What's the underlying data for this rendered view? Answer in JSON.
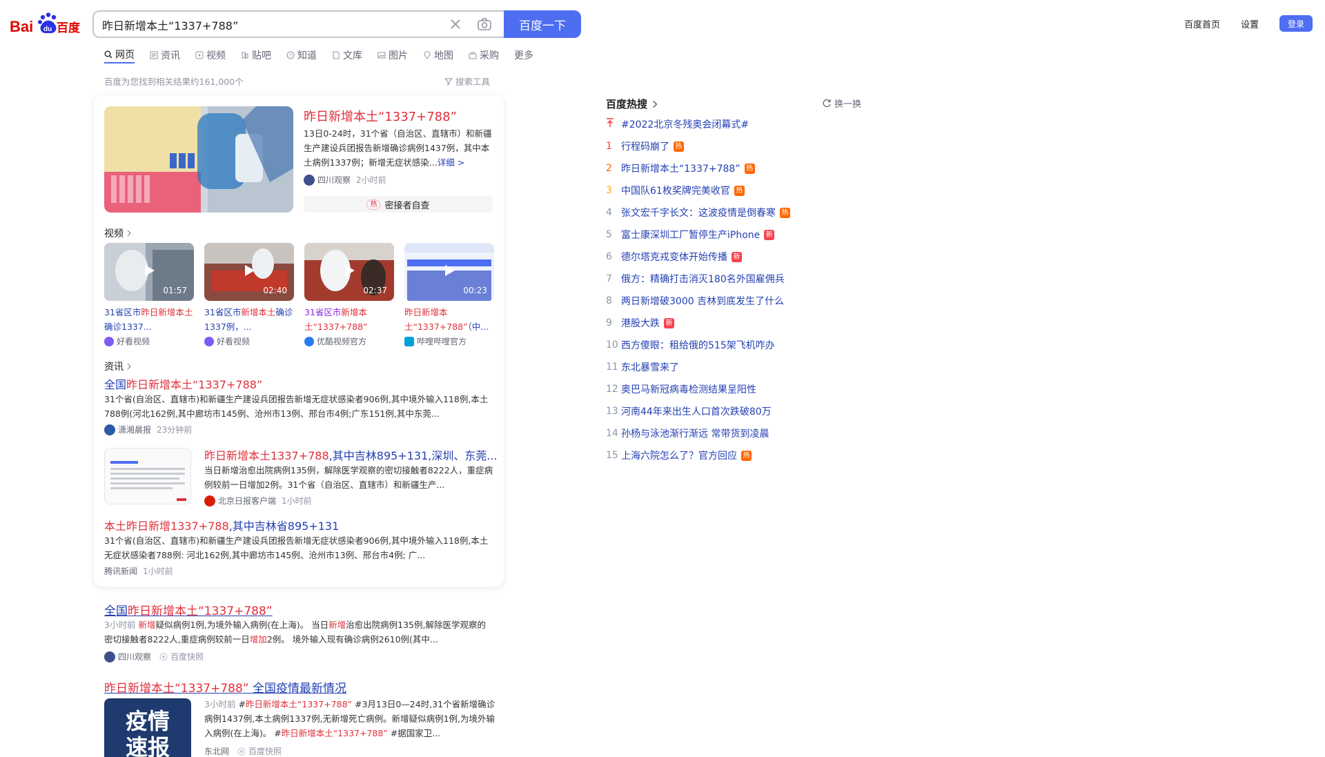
{
  "logo": {
    "text_left": "Bai",
    "text_right": "百度"
  },
  "search": {
    "query": "昨日新增本土“1337+788”",
    "button_label": "百度一下"
  },
  "top_links": {
    "home": "百度首页",
    "settings": "设置",
    "login": "登录"
  },
  "tabs": [
    {
      "label": "网页",
      "icon": "search-icon",
      "active": true
    },
    {
      "label": "资讯",
      "icon": "news-icon"
    },
    {
      "label": "视频",
      "icon": "video-icon"
    },
    {
      "label": "贴吧",
      "icon": "tieba-icon"
    },
    {
      "label": "知道",
      "icon": "question-icon"
    },
    {
      "label": "文库",
      "icon": "doc-icon"
    },
    {
      "label": "图片",
      "icon": "image-icon"
    },
    {
      "label": "地图",
      "icon": "map-icon"
    },
    {
      "label": "采购",
      "icon": "shop-icon"
    },
    {
      "label": "更多"
    }
  ],
  "result_count": "百度为您找到相关结果约161,000个",
  "search_tools": "搜索工具",
  "top_result": {
    "title": "昨日新增本土“1337+788”",
    "abstract": "13日0-24时，31个省（自治区、直辖市）和新疆生产建设兵团报告新增确诊病例1437例，其中本土病例1337例；新增无症状感染...",
    "more": "详细 >",
    "source": "四川观察",
    "time": "2小时前",
    "hot_pill": "热",
    "hot_text": "密接者自查"
  },
  "video_section": {
    "label": "视频",
    "items": [
      {
        "duration": "01:57",
        "title_plain": "31省区市",
        "title_em": "昨日新增本土",
        "title_rest": "确诊1337...",
        "source": "好看视频",
        "src_color": "#7b5cf5"
      },
      {
        "duration": "02:40",
        "title_plain": "31省区市",
        "title_em": "新增本土",
        "title_rest": "确诊1337例，...",
        "source": "好看视频",
        "src_color": "#7b5cf5"
      },
      {
        "duration": "02:37",
        "title_plain": "31省区市",
        "title_em": "新增本土“1337+788”",
        "title_rest": "",
        "source": "优酷视频官方",
        "src_color": "#2a7cf5"
      },
      {
        "duration": "00:23",
        "title_plain": "",
        "title_em": "昨日新增本土“1337+788”",
        "title_rest": "（中...",
        "source": "哔哩哔哩官方",
        "src_color": "#00a1d6"
      }
    ]
  },
  "news_section": {
    "label": "资讯",
    "items": [
      {
        "title_plain": "全国",
        "title_em": "昨日新增本土“1337+788”",
        "title_rest": "",
        "abstract": "31个省(自治区、直辖市)和新疆生产建设兵团报告新增无症状感染者906例,其中境外输入118例,本土788例(河北162例,其中廊坊市145例、沧州市13例、邢台市4例;广东151例,其中东莞...",
        "source": "潇湘晨报",
        "time": "23分钟前"
      },
      {
        "title_plain": "",
        "title_em": "昨日新增本土1337+788",
        "title_rest": ",其中吉林895+131,深圳、东莞...",
        "abstract": "当日新增治愈出院病例135例，解除医学观察的密切接触者8222人，重症病例较前一日增加2例。31个省（自治区、直辖市）和新疆生产...",
        "source": "北京日报客户端",
        "time": "1小时前"
      },
      {
        "title_plain": "本土",
        "title_em": "昨日新增1337+788",
        "title_rest": ",其中吉林省895+131",
        "abstract": "31个省(自治区、直辖市)和新疆生产建设兵团报告新增无症状感染者906例,其中境外输入118例,本土无症状感染者788例: 河北162例,其中廊坊市145例、沧州市13例、邢台市4例; 广...",
        "source": "腾讯新闻",
        "time": "1小时前"
      }
    ]
  },
  "results": [
    {
      "title_plain": "全国",
      "title_em": "昨日新增本土“1337+788”",
      "title_rest": "",
      "time": "3小时前",
      "abstract_parts": [
        "新增",
        "疑似病例1例,为境外输入病例(在上海)。 当日",
        "新增",
        "治愈出院病例135例,解除医学观察的密切接触者8222人,重症病例较前一日",
        "增加",
        "2例。 境外输入现有确诊病例2610例(其中..."
      ],
      "source": "四川观察",
      "snapshot": "百度快照"
    },
    {
      "title_plain": "",
      "title_em": "昨日新增本土“1337+788”",
      "title_rest": " 全国疫情最新情况",
      "time": "3小时前",
      "abstract_parts": [
        "#",
        "昨日新增本土“1337+788”",
        " #3月13日0—24时,31个省新增确诊病例1437例,本土病例1337例,无新增死亡病例。新增疑似病例1例,为境外输入病例(在上海)。 #",
        "昨日新增本土“1337+788”",
        " #据国家卫..."
      ],
      "source": "东北网",
      "snapshot": "百度快照",
      "thumb_text": [
        "疫情",
        "速报"
      ]
    }
  ],
  "hot_search": {
    "title": "百度热搜",
    "refresh": "换一换",
    "items": [
      {
        "idx": "",
        "text": "#2022北京冬残奥会闭幕式#",
        "tag": "",
        "pinned": true
      },
      {
        "idx": "1",
        "text": "行程码崩了",
        "tag": "热"
      },
      {
        "idx": "2",
        "text": "昨日新增本土“1337+788”",
        "tag": "热"
      },
      {
        "idx": "3",
        "text": "中国队61枚奖牌完美收官",
        "tag": "热"
      },
      {
        "idx": "4",
        "text": "张文宏千字长文：这波疫情是倒春寒",
        "tag": "热"
      },
      {
        "idx": "5",
        "text": "富士康深圳工厂暂停生产iPhone",
        "tag": "新"
      },
      {
        "idx": "6",
        "text": "德尔塔克戎变体开始传播",
        "tag": "新"
      },
      {
        "idx": "7",
        "text": "俄方：精确打击消灭180名外国雇佣兵",
        "tag": ""
      },
      {
        "idx": "8",
        "text": "两日新增破3000 吉林到底发生了什么",
        "tag": ""
      },
      {
        "idx": "9",
        "text": "港股大跌",
        "tag": "新"
      },
      {
        "idx": "10",
        "text": "西方傻眼：租给俄的515架飞机咋办",
        "tag": ""
      },
      {
        "idx": "11",
        "text": "东北暴雪来了",
        "tag": ""
      },
      {
        "idx": "12",
        "text": "奥巴马新冠病毒检测结果呈阳性",
        "tag": ""
      },
      {
        "idx": "13",
        "text": "河南44年来出生人口首次跌破80万",
        "tag": ""
      },
      {
        "idx": "14",
        "text": "孙杨与泳池渐行渐远 常带货到凌晨",
        "tag": ""
      },
      {
        "idx": "15",
        "text": "上海六院怎么了？官方回应",
        "tag": "热"
      }
    ]
  },
  "colors": {
    "brand_blue": "#4e6ef2",
    "link_blue": "#2440b3",
    "highlight_red": "#e0303b",
    "hot_orange": "#ff6600",
    "new_red": "#f5424f",
    "rank1": "#fe2d46",
    "rank2": "#f60",
    "rank3": "#faa90e"
  }
}
